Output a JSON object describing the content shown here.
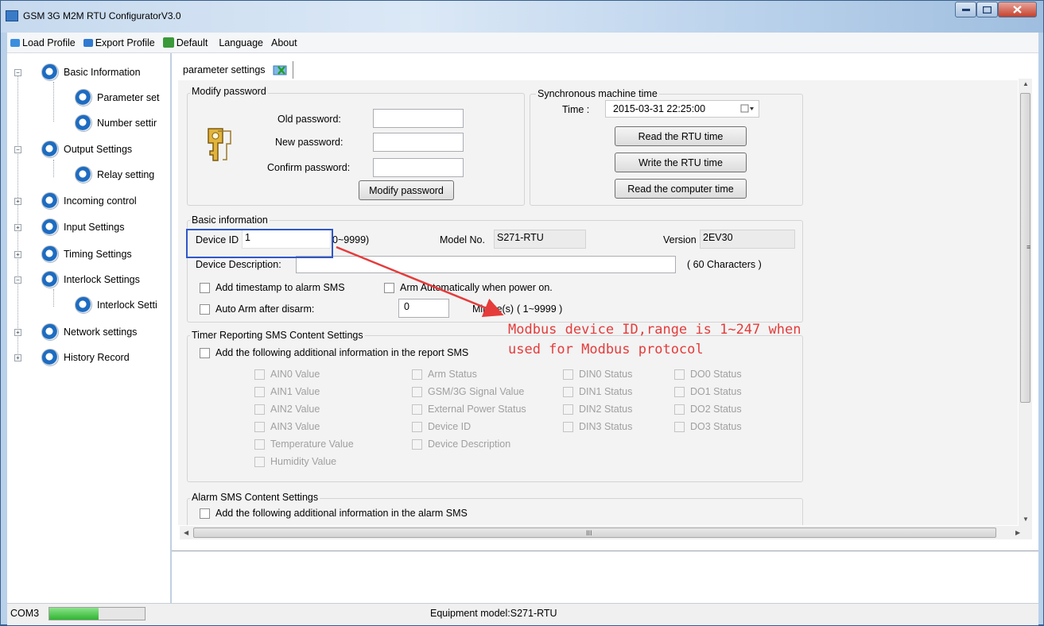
{
  "window": {
    "title": "GSM 3G M2M RTU ConfiguratorV3.0",
    "controls": [
      "minimize",
      "maximize",
      "close"
    ]
  },
  "menu": [
    {
      "label": "Load Profile",
      "icon": "load-icon"
    },
    {
      "label": "Export Profile",
      "icon": "export-icon"
    },
    {
      "label": "Default",
      "icon": "default-icon"
    },
    {
      "label": "Language"
    },
    {
      "label": "About"
    }
  ],
  "sidebar": {
    "items": [
      {
        "label": "Basic Information",
        "expanded": true
      },
      {
        "label": "Parameter set"
      },
      {
        "label": "Number settir"
      },
      {
        "label": "Output Settings",
        "expanded": true
      },
      {
        "label": "Relay setting"
      },
      {
        "label": "Incoming control"
      },
      {
        "label": "Input Settings"
      },
      {
        "label": "Timing Settings"
      },
      {
        "label": "Interlock Settings",
        "expanded": true
      },
      {
        "label": "Interlock Setti"
      },
      {
        "label": "Network settings"
      },
      {
        "label": "History Record"
      }
    ]
  },
  "tab": {
    "label": "parameter settings"
  },
  "password": {
    "title": "Modify password",
    "old_label": "Old password:",
    "new_label": "New password:",
    "confirm_label": "Confirm password:",
    "old_value": "",
    "new_value": "",
    "confirm_value": "",
    "button": "Modify password"
  },
  "sync_time": {
    "title": "Synchronous machine time",
    "time_label": "Time :",
    "time_value": "2015-03-31 22:25:00",
    "read_rtu": "Read the RTU time",
    "write_rtu": "Write the RTU time",
    "read_pc": "Read the computer time"
  },
  "basic": {
    "title": "Basic information",
    "device_id_label": "Device ID",
    "device_id_value": "1",
    "device_id_range": "0~9999)",
    "model_label": "Model No.",
    "model_value": "S271-RTU",
    "version_label": "Version",
    "version_value": "2EV30",
    "description_label": "Device Description:",
    "description_value": "",
    "description_hint": "( 60 Characters )",
    "timestamp_label": "Add timestamp to alarm SMS",
    "arm_auto_label": "Arm Automatically when power on.",
    "auto_arm_label": "Auto Arm after disarm:",
    "minutes_value": "0",
    "minutes_label": "Minute(s)",
    "minutes_range": "( 1~9999 )"
  },
  "timer_sms": {
    "title": "Timer Reporting SMS Content Settings",
    "add_label": "Add the following additional information in the report SMS",
    "options": {
      "col1": [
        "AIN0 Value",
        "AIN1 Value",
        "AIN2 Value",
        "AIN3 Value",
        "Temperature Value",
        "Humidity Value"
      ],
      "col2": [
        "Arm Status",
        "GSM/3G Signal Value",
        "External Power Status",
        "Device ID",
        "Device Description"
      ],
      "col3": [
        "DIN0 Status",
        "DIN1 Status",
        "DIN2 Status",
        "DIN3 Status"
      ],
      "col4": [
        "DO0 Status",
        "DO1 Status",
        "DO2 Status",
        "DO3 Status"
      ]
    }
  },
  "alarm_sms": {
    "title": "Alarm SMS Content Settings",
    "add_label": "Add the following additional information in the alarm SMS"
  },
  "status": {
    "port": "COM3",
    "progress": 0.52,
    "equipment": "Equipment model:S271-RTU"
  },
  "annotation": {
    "line1": "Modbus device ID,range is 1~247 when",
    "line2": "used for Modbus protocol",
    "color": "#e53b3b",
    "box_color": "#2f57c8"
  },
  "scroll": {
    "h_mark": "III"
  }
}
